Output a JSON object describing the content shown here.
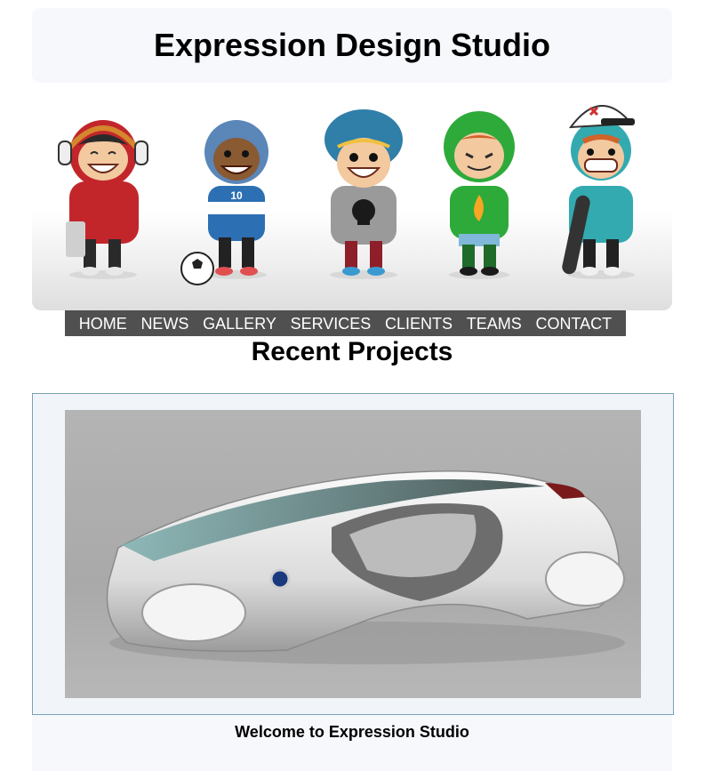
{
  "header": {
    "title": "Expression Design Studio"
  },
  "banner": {
    "characters": [
      {
        "name": "headphones-kid",
        "shirt": "#c2262b"
      },
      {
        "name": "soccer-kid",
        "shirt": "#2d6fb3"
      },
      {
        "name": "skull-shirt-kid",
        "shirt": "#9a9a9a"
      },
      {
        "name": "green-hoodie-kid",
        "shirt": "#2eaa3a"
      },
      {
        "name": "skateboard-kid",
        "shirt": "#33aab0"
      }
    ],
    "jersey_number": "10"
  },
  "nav": {
    "items": [
      {
        "label": "HOME"
      },
      {
        "label": "NEWS"
      },
      {
        "label": "GALLERY"
      },
      {
        "label": "SERVICES"
      },
      {
        "label": "CLIENTS"
      },
      {
        "label": "TEAMS"
      },
      {
        "label": "CONTACT"
      }
    ]
  },
  "recent": {
    "title": "Recent Projects"
  },
  "footer": {
    "welcome": "Welcome to Expression Studio"
  },
  "colors": {
    "nav_bg": "#505050",
    "header_bg": "#f6f8fc",
    "project_border": "#7aa1b8"
  }
}
